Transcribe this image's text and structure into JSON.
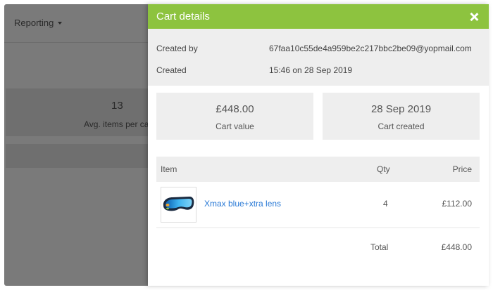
{
  "background": {
    "nav_label": "Reporting",
    "stat_value": "13",
    "stat_label": "Avg. items per car"
  },
  "modal": {
    "title": "Cart details",
    "header_color": "#8dc33f",
    "meta": [
      {
        "label": "Created by",
        "value": "67faa10c55de4a959be2c217bbc2be09@yopmail.com"
      },
      {
        "label": "Created",
        "value": "15:46 on 28 Sep 2019"
      }
    ],
    "cards": [
      {
        "value": "£448.00",
        "label": "Cart value"
      },
      {
        "value": "28 Sep 2019",
        "label": "Cart created"
      }
    ],
    "table": {
      "headers": {
        "item": "Item",
        "qty": "Qty",
        "price": "Price"
      },
      "rows": [
        {
          "icon": "goggles-image",
          "name": "Xmax blue+xtra lens",
          "qty": "4",
          "price": "£112.00"
        }
      ],
      "total_label": "Total",
      "total_value": "£448.00"
    },
    "link_color": "#2a7ad6"
  }
}
